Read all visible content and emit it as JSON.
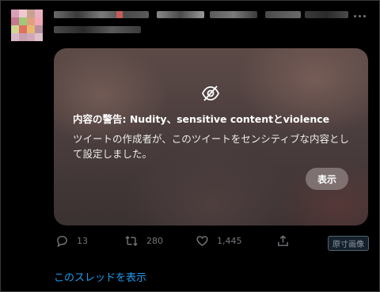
{
  "avatar": {
    "colors": [
      "#d8a0b8",
      "#f0c8d0",
      "#c8a090",
      "#e8b0c0",
      "#c87890",
      "#a0c878",
      "#e0a080",
      "#f0a8b8",
      "#d0d890",
      "#e07060",
      "#e8b870",
      "#b890a0",
      "#d8b8c8",
      "#c8a0b0",
      "#d0a8b8",
      "#e0c0c8"
    ]
  },
  "header": {
    "more_icon": "more-horizontal-icon"
  },
  "media_warning": {
    "icon": "eye-slash-icon",
    "title": "内容の警告: Nudity、sensitive contentとviolence",
    "description": "ツイートの作成者が、このツイートをセンシティブな内容として設定しました。",
    "show_label": "表示"
  },
  "actions": {
    "reply": {
      "icon": "reply-icon",
      "count": "13"
    },
    "retweet": {
      "icon": "retweet-icon",
      "count": "280"
    },
    "like": {
      "icon": "heart-icon",
      "count": "1,445"
    },
    "share": {
      "icon": "share-icon"
    },
    "original_image_label": "原寸画像"
  },
  "thread_link": "このスレッドを表示",
  "colors": {
    "link": "#1d9bf0",
    "muted": "#71767b"
  }
}
